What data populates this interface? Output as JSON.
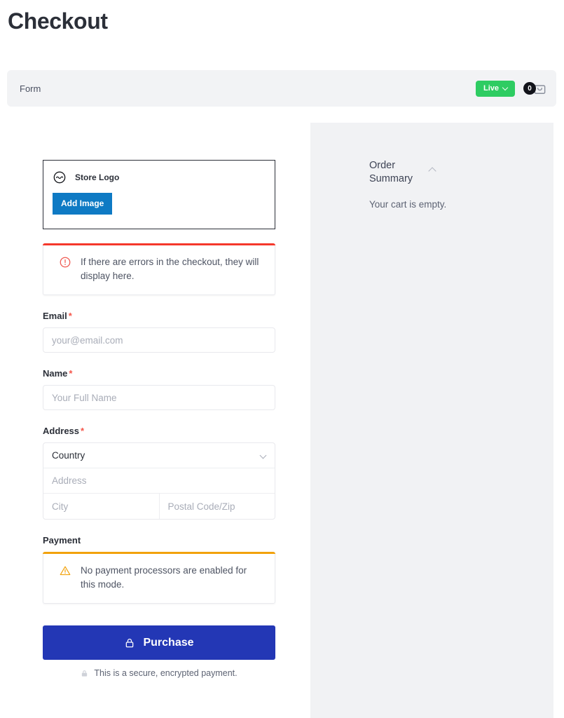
{
  "page": {
    "title": "Checkout"
  },
  "form_bar": {
    "label": "Form",
    "live_label": "Live",
    "cart_count": "0"
  },
  "logo_card": {
    "label": "Store Logo",
    "add_image_label": "Add Image"
  },
  "notices": {
    "error": "If there are errors in the checkout, they will display here.",
    "payment_warning": "No payment processors are enabled for this mode."
  },
  "fields": {
    "email": {
      "label": "Email",
      "required_mark": "*",
      "placeholder": "your@email.com",
      "value": ""
    },
    "name": {
      "label": "Name",
      "required_mark": "*",
      "placeholder": "Your Full Name",
      "value": ""
    },
    "address": {
      "label": "Address",
      "required_mark": "*",
      "country_placeholder": "Country",
      "street_placeholder": "Address",
      "city_placeholder": "City",
      "postal_placeholder": "Postal Code/Zip",
      "country_value": "",
      "street_value": "",
      "city_value": "",
      "postal_value": ""
    },
    "payment": {
      "label": "Payment"
    }
  },
  "purchase": {
    "button_label": "Purchase",
    "secure_note": "This is a secure, encrypted payment."
  },
  "summary": {
    "title": "Order Summary",
    "empty_text": "Your cart is empty."
  },
  "colors": {
    "accent_blue": "#2337b5",
    "add_image_blue": "#0e7ac4",
    "live_green": "#2ecc62",
    "error_red": "#f5382c",
    "warn_orange": "#f2a20c",
    "panel_gray": "#f1f2f4",
    "bar_gray": "#f2f3f5"
  }
}
